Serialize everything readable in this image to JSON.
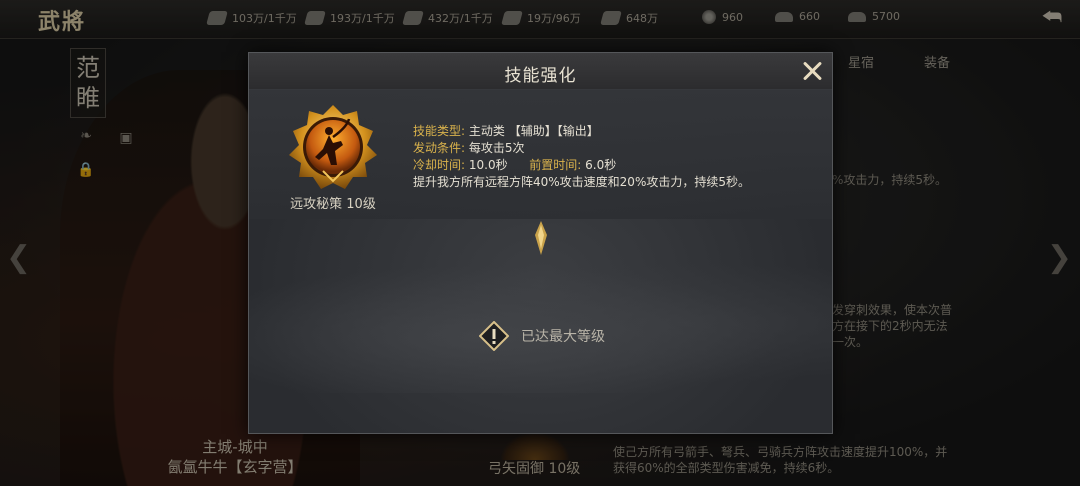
{
  "top": {
    "title": "武將",
    "resources": [
      {
        "icon": "grain-icon",
        "text": "103万/1千万"
      },
      {
        "icon": "wood-icon",
        "text": "193万/1千万"
      },
      {
        "icon": "iron-icon",
        "text": "432万/1千万"
      },
      {
        "icon": "stone-icon",
        "text": "19万/96万"
      },
      {
        "icon": "decree-icon",
        "text": "648万"
      },
      {
        "icon": "copper-coin-icon",
        "text": "960"
      },
      {
        "icon": "gold-ingot-icon",
        "text": "660"
      },
      {
        "icon": "silver-ingot-icon",
        "text": "5700"
      }
    ]
  },
  "hero": {
    "name_line1": "范",
    "name_line2": "睢",
    "location": "主城-城中",
    "title": "氤氲牛牛【玄字营】"
  },
  "right_panel": {
    "tabs": [
      "星宿",
      "装备"
    ],
    "text_1": "%攻击力，持续5秒。",
    "text_2_line1": "发穿刺效果，使本次普",
    "text_2_line2": "方在接下的2秒内无法",
    "text_2_line3": "一次。",
    "bottom_skill": "弓矢固御 10级",
    "bottom_desc": "使己方所有弓箭手、弩兵、弓骑兵方阵攻击速度提升100%，并获得60%的全部类型伤害减免，持续6秒。"
  },
  "modal": {
    "title": "技能强化",
    "skill_name": "远攻秘策 10级",
    "type_label": "技能类型:",
    "type_value": "主动类 【辅助】【输出】",
    "trigger_label": "发动条件:",
    "trigger_value": "每攻击5次",
    "cooldown_label": "冷却时间:",
    "cooldown_value": "10.0秒",
    "precast_label": "前置时间:",
    "precast_value": "6.0秒",
    "description": "提升我方所有远程方阵40%攻击速度和20%攻击力，持续5秒。",
    "max_level_text": "已达最大等级"
  }
}
